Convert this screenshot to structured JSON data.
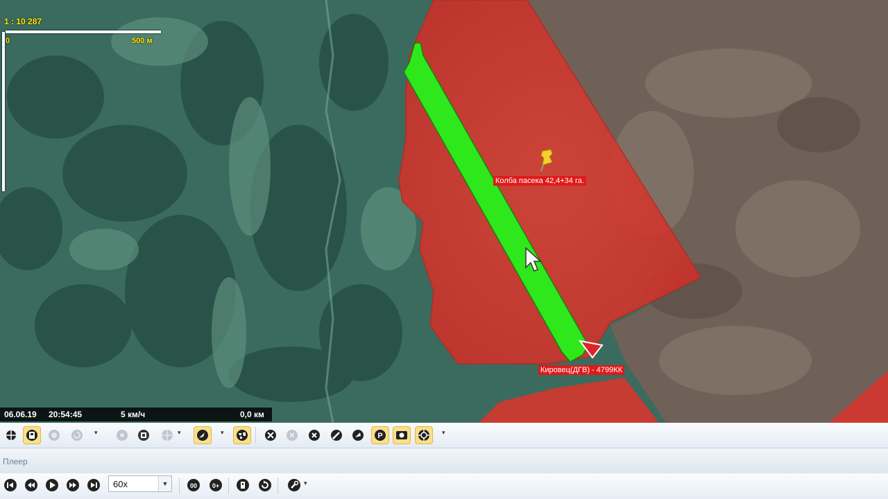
{
  "map": {
    "scale_ratio": "1 : 10 287",
    "scale_zero": "0",
    "scale_end": "500 м",
    "field_label": "Колба пасека 42,4+34 га.",
    "vehicle_label": "Кировец(ДГВ) - 4799КК",
    "colors": {
      "field": "#d8372e",
      "track": "#2ee81c",
      "forest": "#2f5c4f",
      "steppe": "#6e6054"
    }
  },
  "status": {
    "date": "06.06.19",
    "time": "20:54:45",
    "speed": "5 км/ч",
    "distance": "0,0 км"
  },
  "panel": {
    "title": "Плеер"
  },
  "player": {
    "speed_value": "60x"
  },
  "icons": {
    "toolbar": [
      "crosshair-icon",
      "map-layer-icon",
      "disabled-circle-icon",
      "disabled-refresh-icon",
      "disabled-target-icon",
      "film-icon",
      "globe-icon",
      "compass-icon",
      "world-map-icon",
      "stop-icon",
      "disabled-stop-icon",
      "clear-icon",
      "route-icon",
      "vehicle-icon",
      "parking-icon",
      "camera-icon",
      "gps-icon"
    ],
    "player": [
      "skip-start-icon",
      "rewind-icon",
      "play-icon",
      "fast-forward-icon",
      "skip-end-icon",
      "zero-zero-icon",
      "zero-plus-icon",
      "info-icon",
      "refresh-icon",
      "settings-icon"
    ]
  }
}
